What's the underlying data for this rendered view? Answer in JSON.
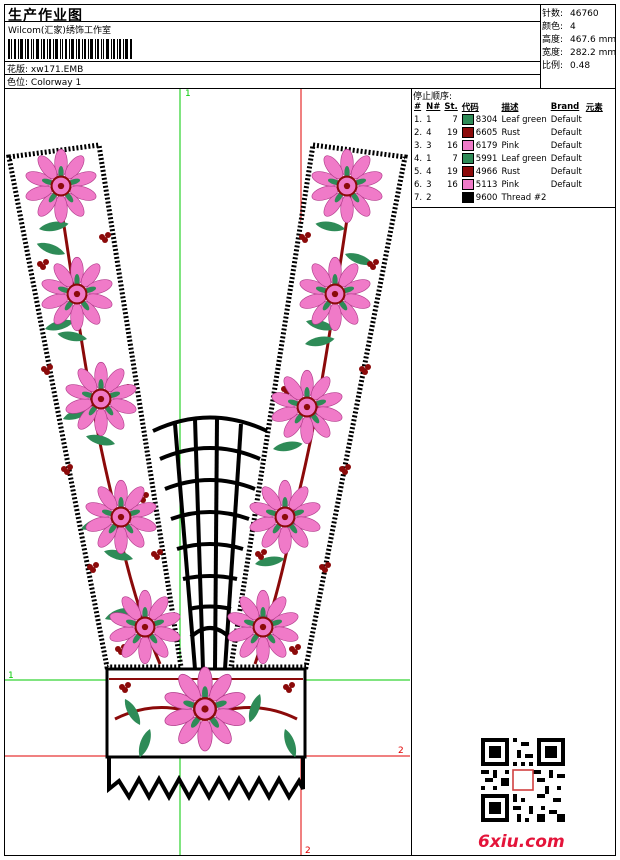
{
  "header": {
    "title": "生产作业图",
    "studio": "Wilcom(汇家)绣饰工作室",
    "design_label": "花版:",
    "design_value": "xw171.EMB",
    "colorway_label": "色位:",
    "colorway_value": "Colorway 1"
  },
  "stats": {
    "stitches_label": "针数:",
    "stitches_value": "46760",
    "colors_label": "颜色:",
    "colors_value": "4",
    "height_label": "高度:",
    "height_value": "467.6 mm",
    "width_label": "宽度:",
    "width_value": "282.2 mm",
    "scale_label": "比例:",
    "scale_value": "0.48"
  },
  "sequence": {
    "title": "停止顺序:",
    "headers": [
      "#",
      "N#",
      "St.",
      "代码",
      "描述",
      "Brand",
      "元素"
    ],
    "rows": [
      {
        "idx": "1.",
        "n": "1",
        "code": "8304",
        "st": "7",
        "desc": "Leaf green",
        "brand": "Default",
        "color": "#2e8b57"
      },
      {
        "idx": "2.",
        "n": "4",
        "code": "6605",
        "st": "19",
        "desc": "Rust",
        "brand": "Default",
        "color": "#8b0a0a"
      },
      {
        "idx": "3.",
        "n": "3",
        "code": "6179",
        "st": "16",
        "desc": "Pink",
        "brand": "Default",
        "color": "#f07ac8"
      },
      {
        "idx": "4.",
        "n": "1",
        "code": "5991",
        "st": "7",
        "desc": "Leaf green",
        "brand": "Default",
        "color": "#2e8b57"
      },
      {
        "idx": "5.",
        "n": "4",
        "code": "4966",
        "st": "19",
        "desc": "Rust",
        "brand": "Default",
        "color": "#8b0a0a"
      },
      {
        "idx": "6.",
        "n": "3",
        "code": "5113",
        "st": "16",
        "desc": "Pink",
        "brand": "Default",
        "color": "#f07ac8"
      },
      {
        "idx": "7.",
        "n": "2",
        "code": "9600",
        "st": "",
        "desc": "Thread #2",
        "brand": "",
        "color": "#000000"
      }
    ]
  },
  "guides": {
    "green_label_top": "1",
    "green_label_left": "1",
    "red_label_right": "2",
    "red_label_bottom": "2"
  },
  "watermark": {
    "site": "6xiu.com"
  },
  "colors": {
    "leaf_green": "#2e8b57",
    "rust": "#8b0a0a",
    "pink": "#f07ac8",
    "outline": "#000000",
    "guide_green": "#00c800",
    "guide_red": "#e00000"
  }
}
